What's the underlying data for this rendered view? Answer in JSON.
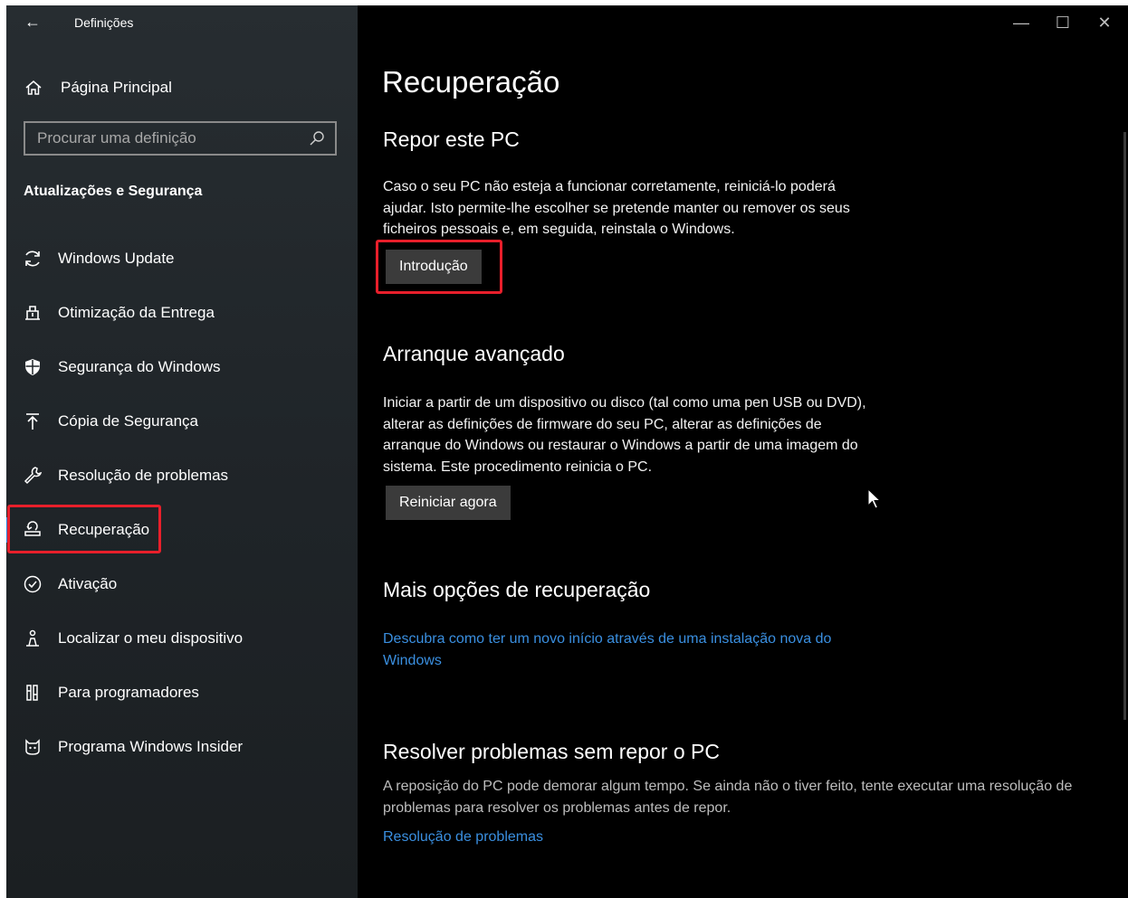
{
  "window": {
    "back_glyph": "←",
    "title": "Definições",
    "controls": {
      "minimize": "—",
      "maximize": "☐",
      "close": "✕"
    }
  },
  "sidebar": {
    "home_label": "Página Principal",
    "search_placeholder": "Procurar uma definição",
    "section_title": "Atualizações e Segurança",
    "items": [
      {
        "label": "Windows Update",
        "icon": "refresh-icon"
      },
      {
        "label": "Otimização da Entrega",
        "icon": "delivery-icon"
      },
      {
        "label": "Segurança do Windows",
        "icon": "shield-icon"
      },
      {
        "label": "Cópia de Segurança",
        "icon": "backup-arrow-icon"
      },
      {
        "label": "Resolução de problemas",
        "icon": "wrench-icon"
      },
      {
        "label": "Recuperação",
        "icon": "recovery-icon",
        "active": true
      },
      {
        "label": "Ativação",
        "icon": "check-circle-icon"
      },
      {
        "label": "Localizar o meu dispositivo",
        "icon": "person-locate-icon"
      },
      {
        "label": "Para programadores",
        "icon": "developer-tools-icon"
      },
      {
        "label": "Programa Windows Insider",
        "icon": "insider-cat-icon"
      }
    ]
  },
  "main": {
    "page_title": "Recuperação",
    "reset": {
      "heading": "Repor este PC",
      "description": "Caso o seu PC não esteja a funcionar corretamente, reiniciá-lo poderá ajudar. Isto permite-lhe escolher se pretende manter ou remover os seus ficheiros pessoais e, em seguida, reinstala o Windows.",
      "button": "Introdução"
    },
    "advanced": {
      "heading": "Arranque avançado",
      "description": "Iniciar a partir de um dispositivo ou disco (tal como uma pen USB ou DVD), alterar as definições de firmware do seu PC, alterar as definições de arranque do Windows ou restaurar o Windows a partir de uma imagem do sistema. Este procedimento reinicia o PC.",
      "button": "Reiniciar agora"
    },
    "more": {
      "heading": "Mais opções de recuperação",
      "link": "Descubra como ter um novo início através de uma instalação nova do Windows"
    },
    "troubleshoot": {
      "heading": "Resolver problemas sem repor o PC",
      "description": "A reposição do PC pode demorar algum tempo. Se ainda não o tiver feito, tente executar uma resolução de problemas para resolver os problemas antes de repor.",
      "link": "Resolução de problemas"
    }
  },
  "colors": {
    "accent": "#2b7fd6",
    "link": "#3a8fe0",
    "highlight": "#e81f2b",
    "button_bg": "#3b3b3b"
  }
}
